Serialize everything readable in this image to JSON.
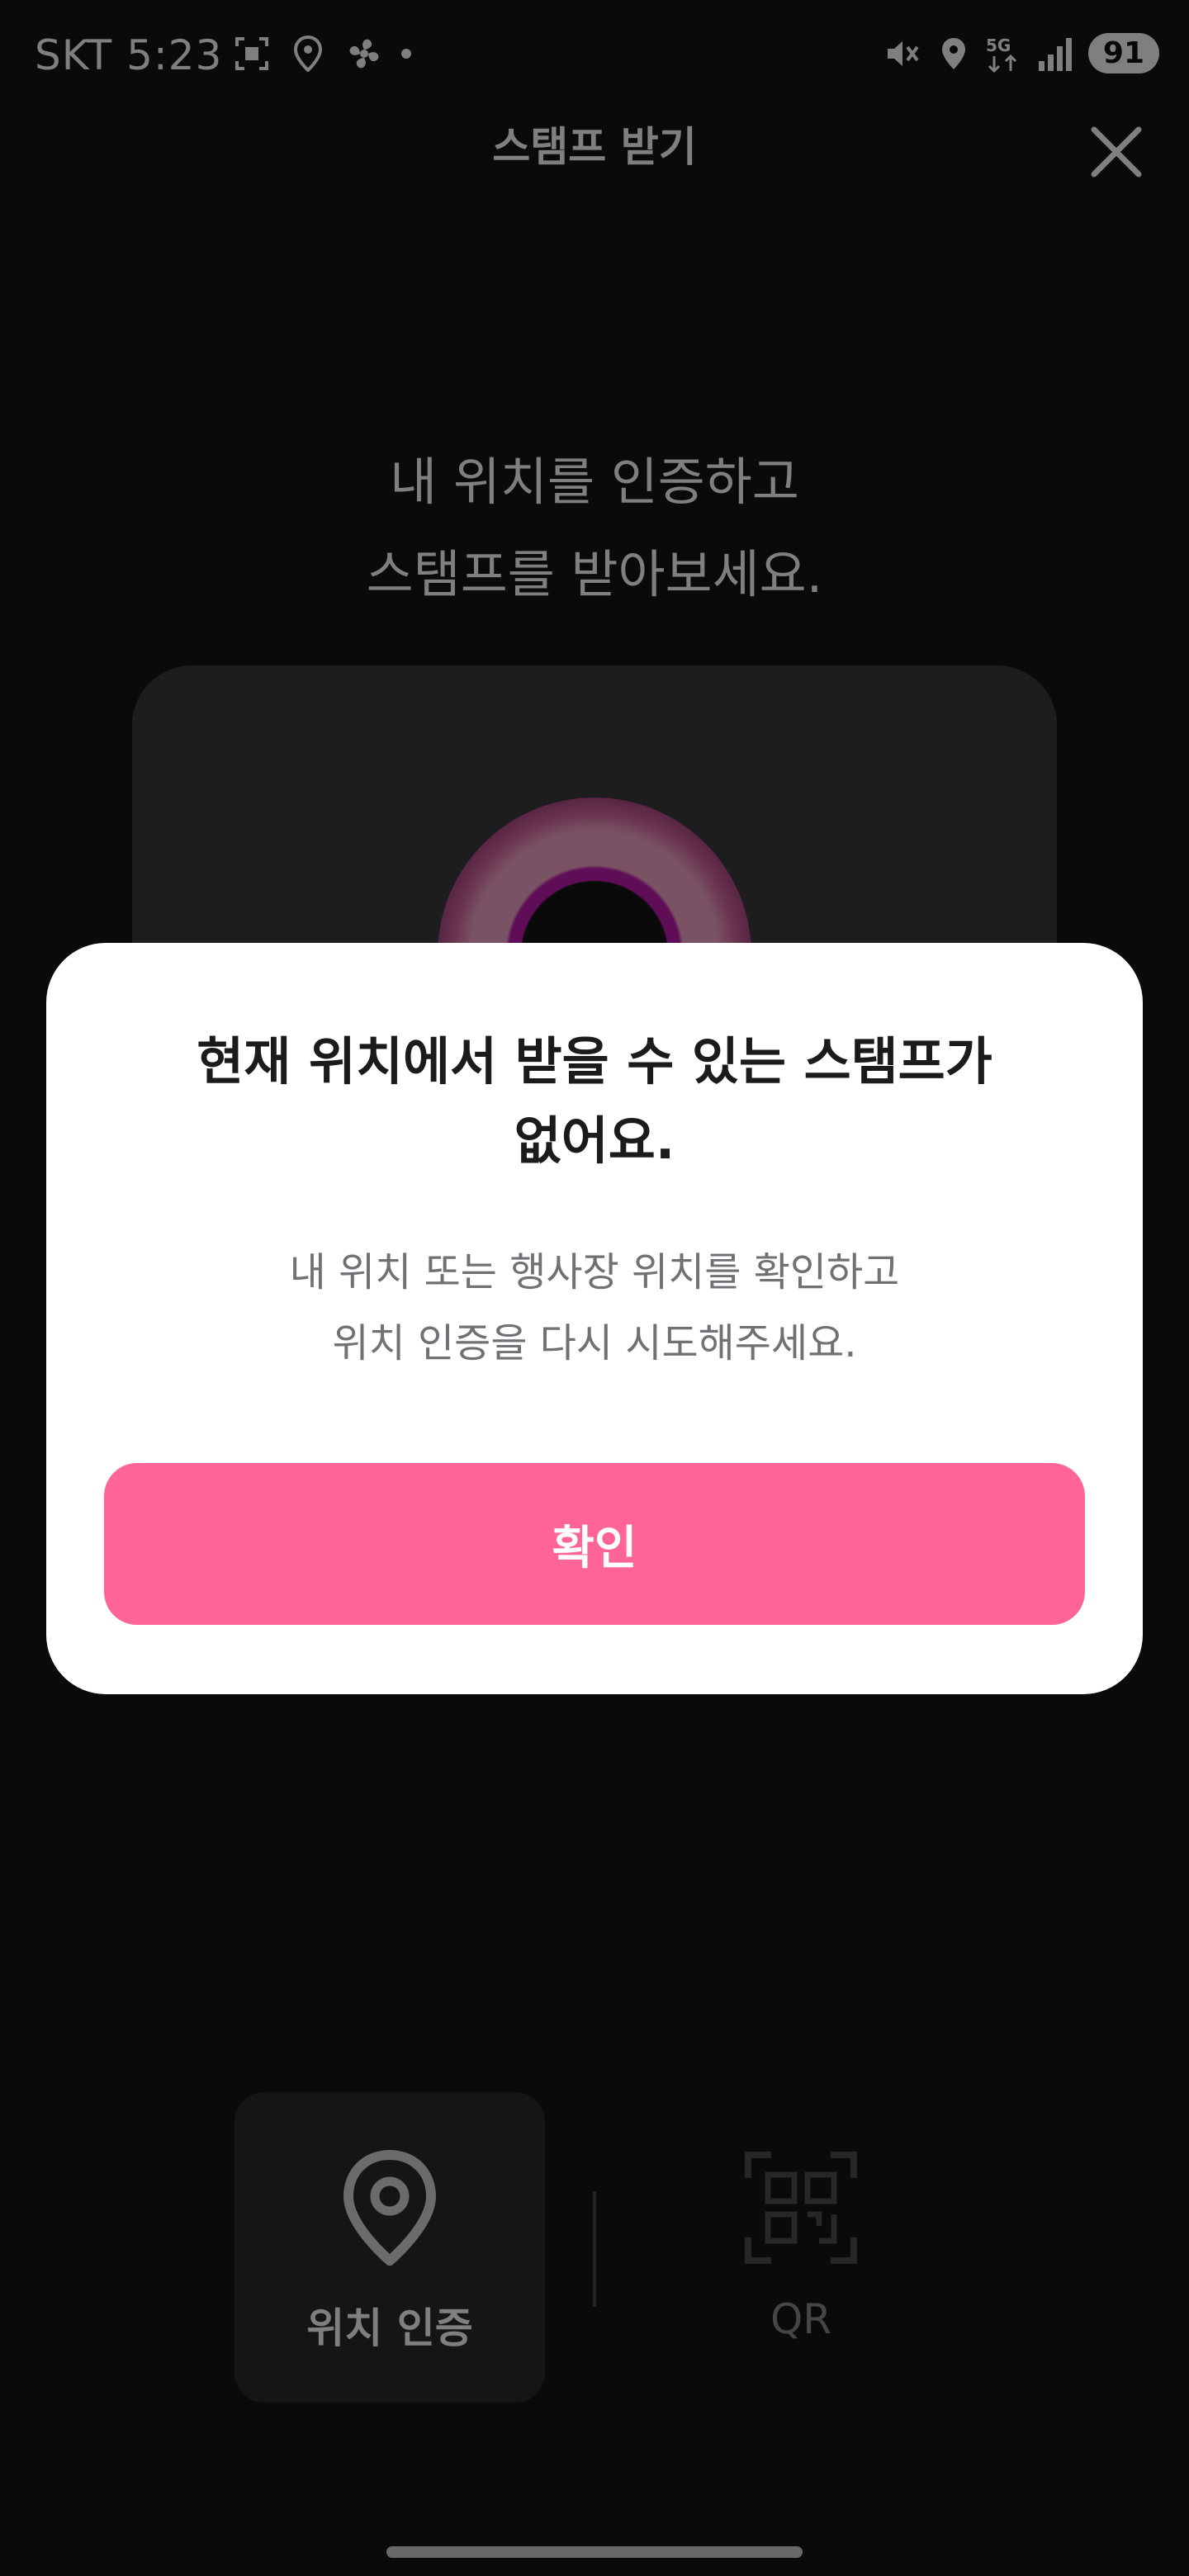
{
  "status_bar": {
    "carrier": "SKT",
    "time": "5:23",
    "battery": "91"
  },
  "header": {
    "title": "스탬프 받기"
  },
  "instruction": {
    "line1": "내 위치를 인증하고",
    "line2": "스탬프를 받아보세요."
  },
  "tabs": {
    "location": {
      "label": "위치 인증",
      "icon": "location-pin-icon"
    },
    "qr": {
      "label": "QR",
      "icon": "qr-scan-icon"
    }
  },
  "dialog": {
    "title_line1": "현재 위치에서 받을 수 있는 스탬프가",
    "title_line2": "없어요.",
    "message_line1": "내 위치 또는 행사장 위치를 확인하고",
    "message_line2": "위치 인증을 다시 시도해주세요.",
    "confirm_label": "확인"
  },
  "colors": {
    "accent": "#ff6499",
    "background": "#141416"
  }
}
